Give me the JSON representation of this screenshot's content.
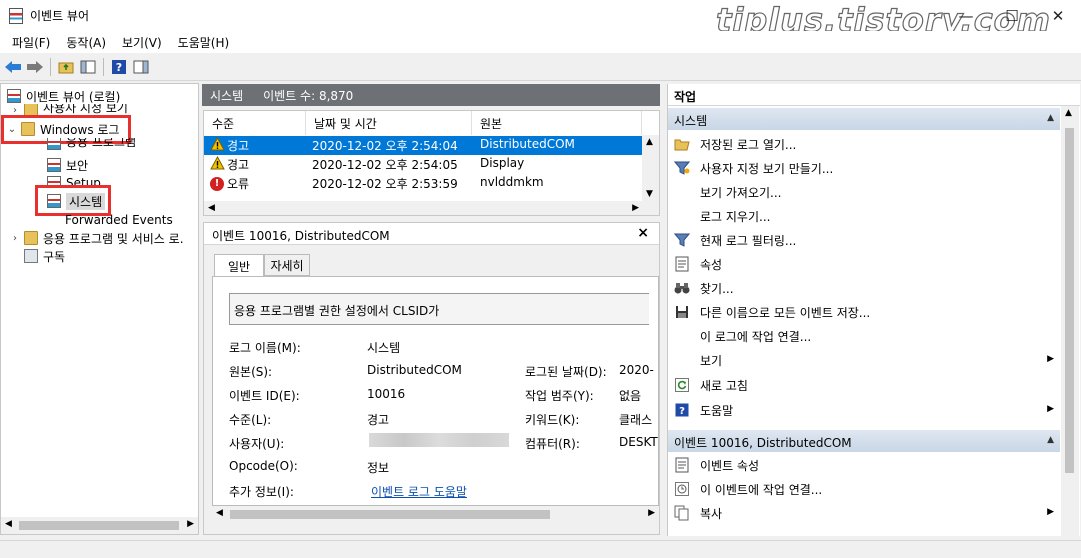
{
  "window": {
    "title": "이벤트 뷰어",
    "watermark": "tiplus.tistory.com",
    "minimize": "—",
    "maximize": "☐",
    "close": "✕"
  },
  "menu": [
    "파일(F)",
    "동작(A)",
    "보기(V)",
    "도움말(H)"
  ],
  "tree": {
    "root": "이벤트 뷰어 (로컬)",
    "custom_views": "사용자 지정 보기",
    "windows_logs": "Windows 로그",
    "application": "응용 프로그램",
    "security": "보안",
    "setup": "Setup",
    "system": "시스템",
    "forwarded": "Forwarded Events",
    "apps_services": "응용 프로그램 및 서비스 로.",
    "subscriptions": "구독"
  },
  "list": {
    "header_name": "시스템",
    "header_count": "이벤트 수: 8,870",
    "columns": [
      "수준",
      "날짜 및 시간",
      "원본"
    ],
    "rows": [
      {
        "level": "경고",
        "date": "2020-12-02 오후 2:54:04",
        "source": "DistributedCOM",
        "type": "warn"
      },
      {
        "level": "경고",
        "date": "2020-12-02 오후 2:54:05",
        "source": "Display",
        "type": "warn"
      },
      {
        "level": "오류",
        "date": "2020-12-02 오후 2:53:59",
        "source": "nvlddmkm",
        "type": "error"
      }
    ]
  },
  "detail": {
    "title": "이벤트 10016, DistributedCOM",
    "close": "×",
    "tabs": [
      "일반",
      "자세히"
    ],
    "description": "응용 프로그램별 권한 설정에서 CLSID가",
    "fields": {
      "log_name_label": "로그 이름(M):",
      "log_name": "시스템",
      "source_label": "원본(S):",
      "source": "DistributedCOM",
      "logged_label": "로그된 날짜(D):",
      "logged": "2020-",
      "event_id_label": "이벤트 ID(E):",
      "event_id": "10016",
      "category_label": "작업 범주(Y):",
      "category": "없음",
      "level_label": "수준(L):",
      "level": "경고",
      "keywords_label": "키워드(K):",
      "keywords": "클래스",
      "user_label": "사용자(U):",
      "computer_label": "컴퓨터(R):",
      "computer": "DESKT",
      "opcode_label": "Opcode(O):",
      "opcode": "정보",
      "more_info_label": "추가 정보(I):",
      "more_info_link": "이벤트 로그 도움말"
    }
  },
  "actions": {
    "title": "작업",
    "section_system": "시스템",
    "system_items": [
      "저장된 로그 열기...",
      "사용자 지정 보기 만들기...",
      "보기 가져오기...",
      "로그 지우기...",
      "현재 로그 필터링...",
      "속성",
      "찾기...",
      "다른 이름으로 모든 이벤트 저장...",
      "이 로그에 작업 연결...",
      "보기",
      "새로 고침",
      "도움말"
    ],
    "section_event": "이벤트 10016, DistributedCOM",
    "event_items": [
      "이벤트 속성",
      "이 이벤트에 작업 연결...",
      "복사"
    ]
  },
  "colors": {
    "highlight_box": "#e8312f",
    "selection": "#0078d7",
    "header_bg": "#6d7075"
  }
}
